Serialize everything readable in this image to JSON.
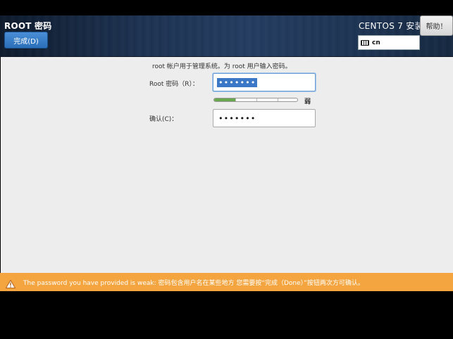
{
  "header": {
    "spoke_title": "ROOT 密码",
    "done_button": "完成(D)",
    "product_title": "CENTOS 7 安装",
    "keyboard_layout": "cn",
    "help_button": "帮助！"
  },
  "main": {
    "description": "root 帐户用于管理系统。为 root 用户输入密码。",
    "password_label": "Root 密码（R）：",
    "password_value": "•••••••",
    "strength_label": "弱",
    "strength_level": 0.25,
    "confirm_label": "确认(C)：",
    "confirm_value": "•••••••"
  },
  "warning": {
    "text": "The password you have provided is weak: 密码包含用户名在某些地方 您需要按“完成（Done）”按钮两次方可确认。",
    "color": "#f5a53f"
  },
  "colors": {
    "accent": "#2a6fb8",
    "strength_fill": "#6aa84f"
  }
}
